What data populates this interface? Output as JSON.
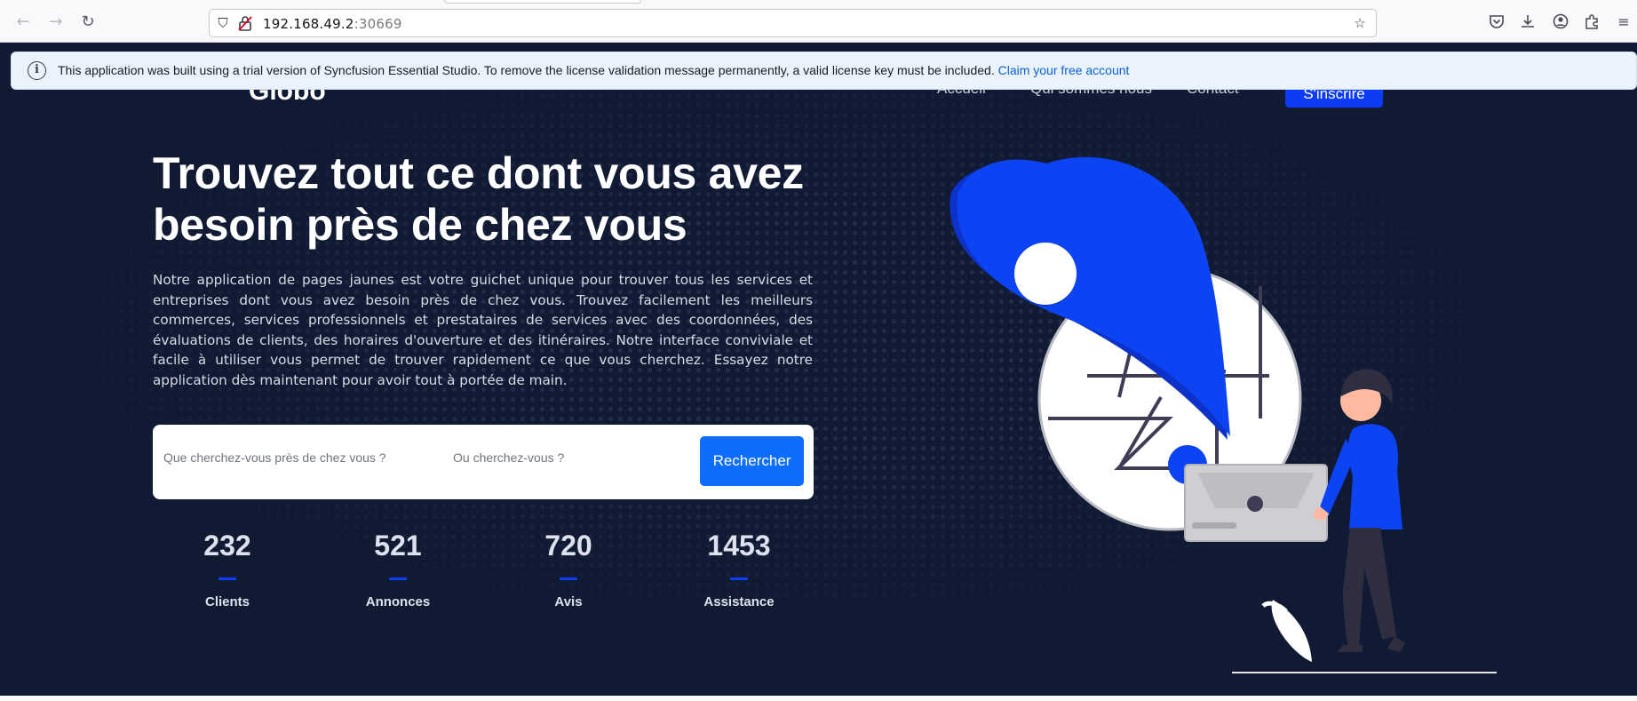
{
  "browser": {
    "url_host": "192.168.49.2",
    "url_port": ":30669",
    "icons": [
      "back-icon",
      "forward-icon",
      "reload-icon",
      "shield-icon",
      "insecure-lock-icon",
      "star-icon",
      "pocket-icon",
      "download-icon",
      "account-icon",
      "extensions-icon",
      "menu-icon"
    ]
  },
  "nav": {
    "brand": "Globo",
    "links": [
      "Accueil",
      "Qui sommes nous",
      "Contact"
    ],
    "signup": "S'inscrire"
  },
  "banner": {
    "message": "This application was built using a trial version of Syncfusion Essential Studio. To remove the license validation message permanently, a valid license key must be included.",
    "link": "Claim your free account"
  },
  "hero": {
    "title": "Trouvez tout ce dont vous avez besoin près de chez vous",
    "description": "Notre application de pages jaunes est votre guichet unique pour trouver tous les services et entreprises dont vous avez besoin près de chez vous. Trouvez facilement les meilleurs commerces, services professionnels et prestataires de services avec des coordonnées, des évaluations de clients, des horaires d'ouverture et des itinéraires. Notre interface conviviale et facile à utiliser vous permet de trouver rapidement ce que vous cherchez. Essayez notre application dès maintenant pour avoir tout à portée de main."
  },
  "search": {
    "what_placeholder": "Que cherchez-vous près de chez vous ?",
    "where_placeholder": "Ou cherchez-vous ?",
    "button": "Rechercher"
  },
  "stats": [
    {
      "value": "232",
      "label": "Clients"
    },
    {
      "value": "521",
      "label": "Annonces"
    },
    {
      "value": "720",
      "label": "Avis"
    },
    {
      "value": "1453",
      "label": "Assistance"
    }
  ],
  "colors": {
    "page_bg": "#111a33",
    "accent_blue": "#0d3cf5",
    "button_blue": "#0d6efd",
    "banner_bg": "#eaf2fc",
    "link_blue": "#0a62d8"
  }
}
